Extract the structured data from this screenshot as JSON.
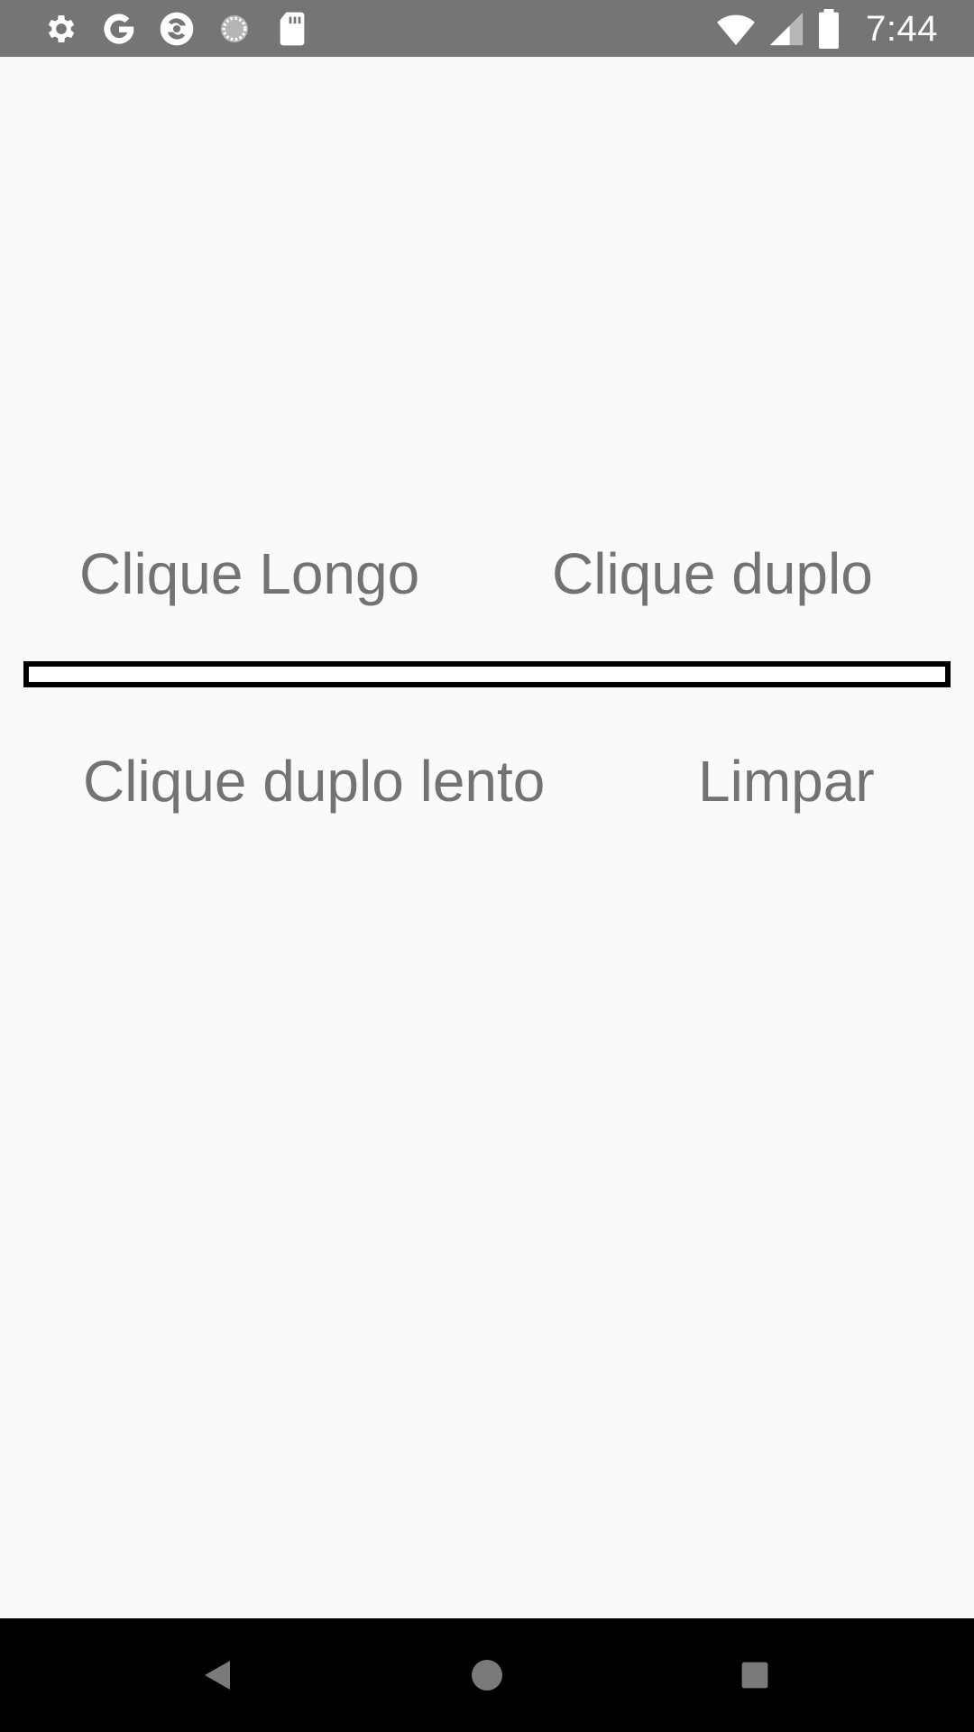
{
  "status_bar": {
    "time": "7:44",
    "left_icons": [
      "settings-icon",
      "google-icon",
      "app-sync-icon",
      "loading-icon",
      "sd-card-icon"
    ],
    "right_icons": [
      "wifi-icon",
      "cell-signal-icon",
      "battery-icon"
    ],
    "background_color": "#757575"
  },
  "main": {
    "buttons": {
      "long_click": "Clique Longo",
      "double_click": "Clique duplo",
      "slow_double_click": "Clique duplo lento",
      "clear": "Limpar"
    },
    "output_text": "",
    "text_color": "#737373",
    "background_color": "#fafafa"
  },
  "nav_bar": {
    "buttons": [
      "back-icon",
      "home-icon",
      "recents-icon"
    ],
    "background_color": "#000000"
  }
}
